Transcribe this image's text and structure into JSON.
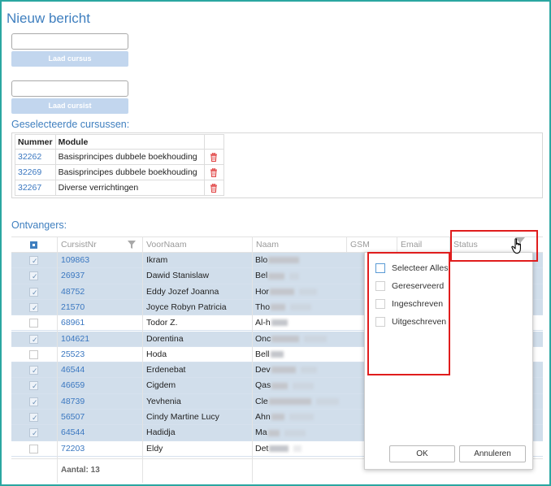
{
  "page": {
    "title": "Nieuw bericht"
  },
  "course_input": {
    "value": "",
    "button_label": "Laad cursus"
  },
  "student_input": {
    "value": "",
    "button_label": "Laad cursist"
  },
  "selected_courses": {
    "title": "Geselecteerde cursussen:",
    "columns": [
      "Nummer",
      "Module"
    ],
    "rows": [
      {
        "nummer": "32262",
        "module": "Basisprincipes dubbele boekhouding"
      },
      {
        "nummer": "32269",
        "module": "Basisprincipes dubbele boekhouding"
      },
      {
        "nummer": "32267",
        "module": "Diverse verrichtingen"
      }
    ]
  },
  "recipients": {
    "title": "Ontvangers:",
    "columns": {
      "cursistnr": "CursistNr",
      "voornaam": "VoorNaam",
      "naam": "Naam",
      "gsm": "GSM",
      "email": "Email",
      "status": "Status"
    },
    "rows": [
      {
        "selected": true,
        "nr": "109863",
        "voornaam": "Ikram",
        "naam": "Blo"
      },
      {
        "selected": true,
        "nr": "26937",
        "voornaam": "Dawid Stanislaw",
        "naam": "Bel"
      },
      {
        "selected": true,
        "nr": "48752",
        "voornaam": "Eddy Jozef Joanna",
        "naam": "Hor"
      },
      {
        "selected": true,
        "nr": "21570",
        "voornaam": "Joyce Robyn Patricia",
        "naam": "Tho"
      },
      {
        "selected": false,
        "nr": "68961",
        "voornaam": "Todor Z.",
        "naam": "Al-h"
      },
      {
        "selected": true,
        "nr": "104621",
        "voornaam": "Dorentina",
        "naam": "Onc"
      },
      {
        "selected": false,
        "nr": "25523",
        "voornaam": "Hoda",
        "naam": "Bell"
      },
      {
        "selected": true,
        "nr": "46544",
        "voornaam": "Erdenebat",
        "naam": "Dev"
      },
      {
        "selected": true,
        "nr": "46659",
        "voornaam": "Cigdem",
        "naam": "Qas"
      },
      {
        "selected": true,
        "nr": "48739",
        "voornaam": "Yevhenia",
        "naam": "Cle"
      },
      {
        "selected": true,
        "nr": "56507",
        "voornaam": "Cindy Martine Lucy",
        "naam": "Ahn"
      },
      {
        "selected": true,
        "nr": "64544",
        "voornaam": "Hadidja",
        "naam": "Ma"
      },
      {
        "selected": false,
        "nr": "72203",
        "voornaam": "Eldy",
        "naam": "Det"
      }
    ],
    "footer": "Aantal: 13"
  },
  "status_filter": {
    "options": [
      "Selecteer Alles",
      "Gereserveerd",
      "Ingeschreven",
      "Uitgeschreven"
    ],
    "ok_label": "OK",
    "cancel_label": "Annuleren"
  },
  "colors": {
    "accent": "#3f7fbf",
    "selected_row": "#d1deeb",
    "highlight": "#e01d1d",
    "frame": "#2aa6a1"
  }
}
